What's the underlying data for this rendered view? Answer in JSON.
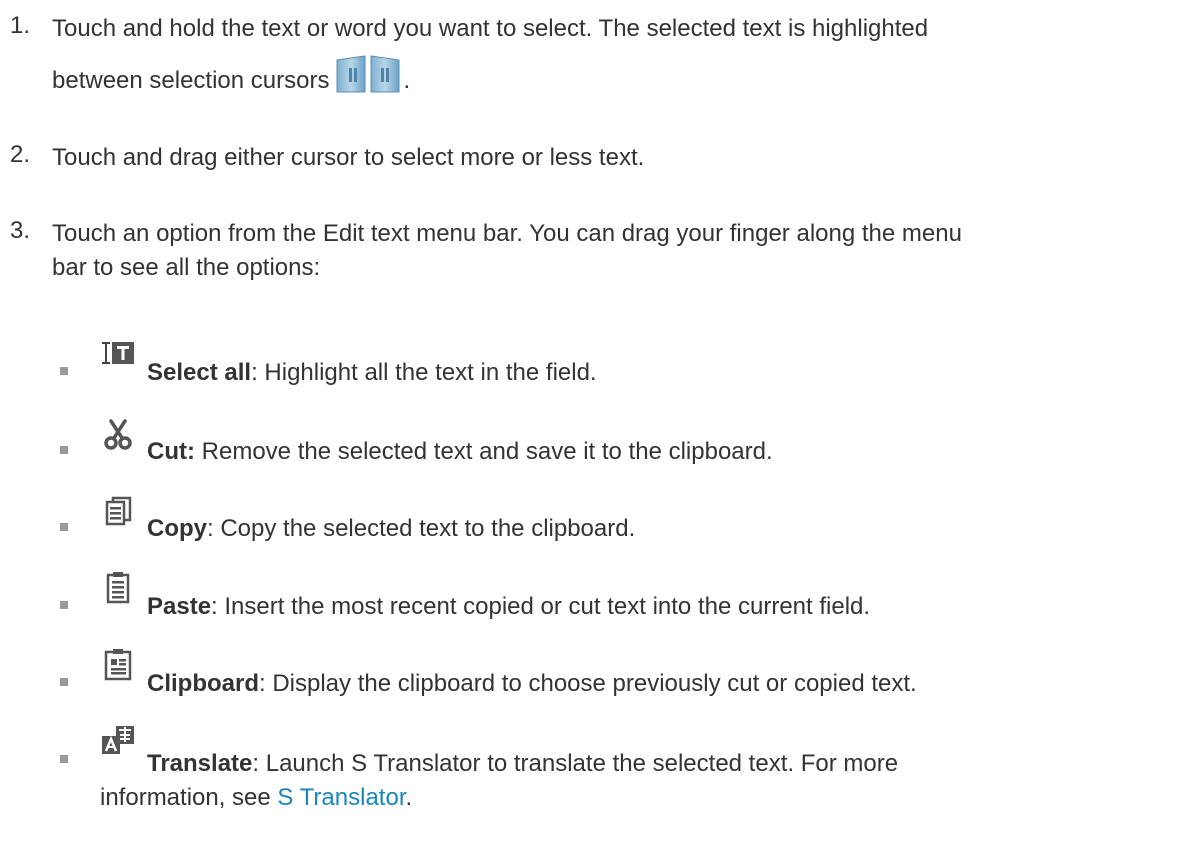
{
  "steps": [
    {
      "number": "1.",
      "line1": "Touch and hold the text or word you want to select. The selected text is highlighted",
      "line2": "between selection cursors",
      "line2_end": "."
    },
    {
      "number": "2.",
      "line1": "Touch and drag either cursor to select more or less text."
    },
    {
      "number": "3.",
      "line1": "Touch an option from the Edit text menu bar. You can drag your finger along the menu",
      "line2": "bar to see all the options:"
    }
  ],
  "options": [
    {
      "icon": "select-all-icon",
      "label": "Select all",
      "desc": ": Highlight all the text in the field."
    },
    {
      "icon": "cut-icon",
      "label": "Cut:",
      "desc": " Remove the selected text and save it to the clipboard."
    },
    {
      "icon": "copy-icon",
      "label": "Copy",
      "desc": ": Copy the selected text to the clipboard."
    },
    {
      "icon": "paste-icon",
      "label": "Paste",
      "desc": ": Insert the most recent copied or cut text into the current field."
    },
    {
      "icon": "clipboard-icon",
      "label": "Clipboard",
      "desc": ": Display the clipboard to choose previously cut or copied text."
    },
    {
      "icon": "translate-icon",
      "label": "Translate",
      "desc": ": Launch S Translator to translate the selected text. For more",
      "desc_line2": "information, see ",
      "link": "S Translator",
      "desc_end": "."
    }
  ],
  "colors": {
    "text": "#333333",
    "link": "#1a86b8",
    "bullet": "#9a9a9a"
  }
}
